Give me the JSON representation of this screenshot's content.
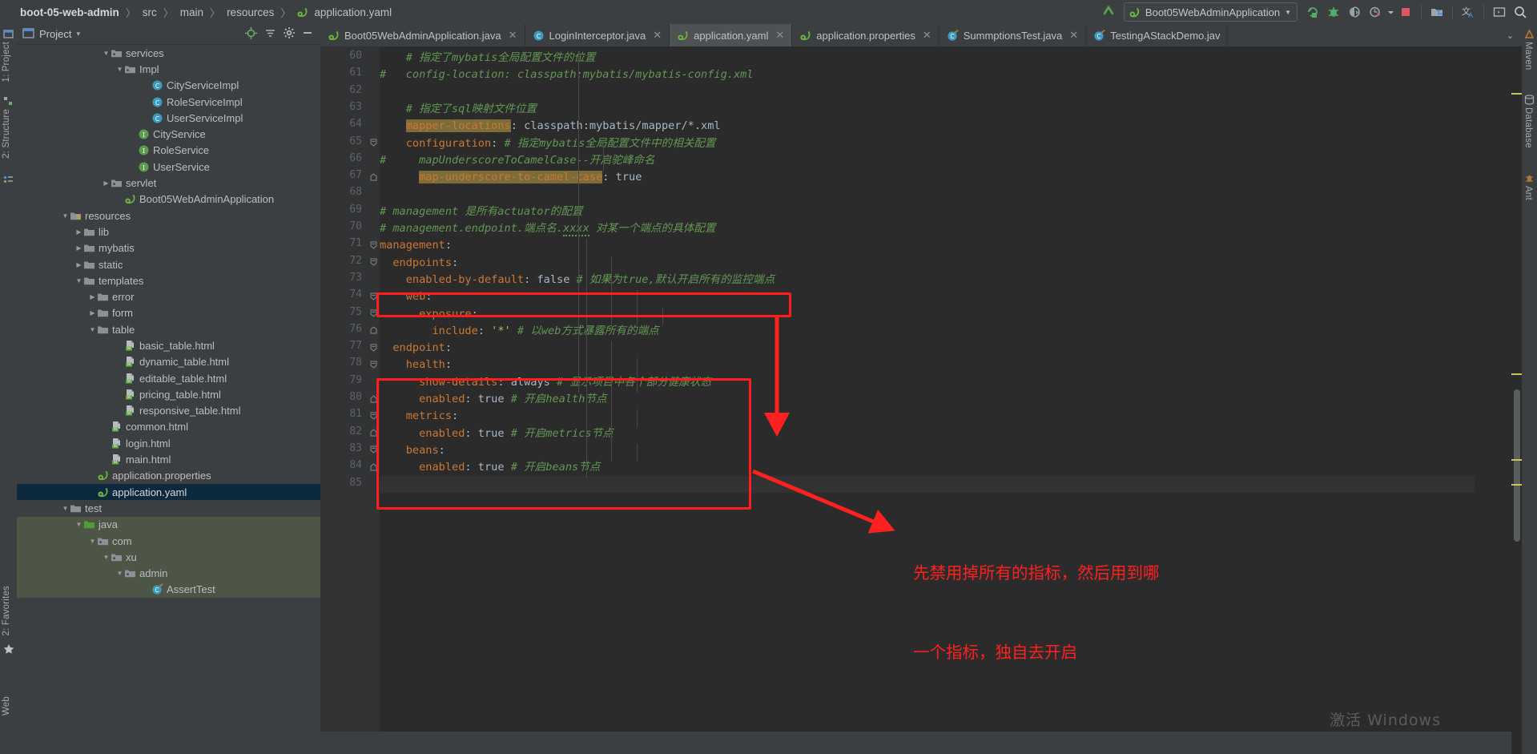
{
  "navbar": {
    "breadcrumbs": [
      "boot-05-web-admin",
      "src",
      "main",
      "resources",
      "application.yaml"
    ],
    "separator": "〉",
    "back_arrow": "↖",
    "run_config": "Boot05WebAdminApplication",
    "run_config_caret": "▼",
    "icons": [
      "rerun-icon",
      "debug-icon",
      "run-with-coverage-icon",
      "profiler-icon",
      "profiler-dropdown-icon",
      "stop-icon",
      "project-structure-icon",
      "translate-icon",
      "terminal-icon",
      "search-everywhere-icon"
    ]
  },
  "left_strip": {
    "project_label": "1: Project",
    "structure_label": "2: Structure",
    "favorites_label": "2: Favorites",
    "web_label": "Web"
  },
  "right_strip": {
    "maven_label": "Maven",
    "database_label": "Database",
    "ant_label": "Ant"
  },
  "project_panel": {
    "title": "Project",
    "caret": "▾",
    "header_icons": [
      "locate-icon",
      "collapse-all-icon",
      "settings-gear-icon",
      "hide-icon"
    ],
    "tree": [
      {
        "label": "services",
        "indent": 6,
        "arrow": "down",
        "icon": "package-folder",
        "type": "pkg"
      },
      {
        "label": "Impl",
        "indent": 7,
        "arrow": "down",
        "icon": "package-folder",
        "type": "pkg"
      },
      {
        "label": "CityServiceImpl",
        "indent": 9,
        "arrow": "none",
        "icon": "class-icon",
        "type": "class"
      },
      {
        "label": "RoleServiceImpl",
        "indent": 9,
        "arrow": "none",
        "icon": "class-icon",
        "type": "class"
      },
      {
        "label": "UserServiceImpl",
        "indent": 9,
        "arrow": "none",
        "icon": "class-icon",
        "type": "class"
      },
      {
        "label": "CityService",
        "indent": 8,
        "arrow": "none",
        "icon": "interface-icon",
        "type": "iface"
      },
      {
        "label": "RoleService",
        "indent": 8,
        "arrow": "none",
        "icon": "interface-icon",
        "type": "iface"
      },
      {
        "label": "UserService",
        "indent": 8,
        "arrow": "none",
        "icon": "interface-icon",
        "type": "iface"
      },
      {
        "label": "servlet",
        "indent": 6,
        "arrow": "right",
        "icon": "package-folder",
        "type": "pkg"
      },
      {
        "label": "Boot05WebAdminApplication",
        "indent": 7,
        "arrow": "none",
        "icon": "spring-class",
        "type": "spring"
      },
      {
        "label": "resources",
        "indent": 3,
        "arrow": "down",
        "icon": "resources-folder",
        "type": "res"
      },
      {
        "label": "lib",
        "indent": 4,
        "arrow": "right",
        "icon": "folder",
        "type": "folder"
      },
      {
        "label": "mybatis",
        "indent": 4,
        "arrow": "right",
        "icon": "folder",
        "type": "folder"
      },
      {
        "label": "static",
        "indent": 4,
        "arrow": "right",
        "icon": "folder",
        "type": "folder"
      },
      {
        "label": "templates",
        "indent": 4,
        "arrow": "down",
        "icon": "folder",
        "type": "folder"
      },
      {
        "label": "error",
        "indent": 5,
        "arrow": "right",
        "icon": "folder",
        "type": "folder"
      },
      {
        "label": "form",
        "indent": 5,
        "arrow": "right",
        "icon": "folder",
        "type": "folder"
      },
      {
        "label": "table",
        "indent": 5,
        "arrow": "down",
        "icon": "folder",
        "type": "folder"
      },
      {
        "label": "basic_table.html",
        "indent": 7,
        "arrow": "none",
        "icon": "html-file",
        "type": "html"
      },
      {
        "label": "dynamic_table.html",
        "indent": 7,
        "arrow": "none",
        "icon": "html-file",
        "type": "html"
      },
      {
        "label": "editable_table.html",
        "indent": 7,
        "arrow": "none",
        "icon": "html-file",
        "type": "html"
      },
      {
        "label": "pricing_table.html",
        "indent": 7,
        "arrow": "none",
        "icon": "html-file",
        "type": "html"
      },
      {
        "label": "responsive_table.html",
        "indent": 7,
        "arrow": "none",
        "icon": "html-file",
        "type": "html"
      },
      {
        "label": "common.html",
        "indent": 6,
        "arrow": "none",
        "icon": "html-file",
        "type": "html"
      },
      {
        "label": "login.html",
        "indent": 6,
        "arrow": "none",
        "icon": "html-file",
        "type": "html"
      },
      {
        "label": "main.html",
        "indent": 6,
        "arrow": "none",
        "icon": "html-file",
        "type": "html"
      },
      {
        "label": "application.properties",
        "indent": 5,
        "arrow": "none",
        "icon": "spring-file",
        "type": "spring"
      },
      {
        "label": "application.yaml",
        "indent": 5,
        "arrow": "none",
        "icon": "spring-file",
        "type": "spring",
        "selected": true
      },
      {
        "label": "test",
        "indent": 3,
        "arrow": "down",
        "icon": "folder",
        "type": "folder"
      },
      {
        "label": "java",
        "indent": 4,
        "arrow": "down",
        "icon": "source-folder",
        "type": "srcfolder",
        "testbg": true
      },
      {
        "label": "com",
        "indent": 5,
        "arrow": "down",
        "icon": "package-folder",
        "type": "pkg",
        "testbg": true
      },
      {
        "label": "xu",
        "indent": 6,
        "arrow": "down",
        "icon": "package-folder",
        "type": "pkg",
        "testbg": true
      },
      {
        "label": "admin",
        "indent": 7,
        "arrow": "down",
        "icon": "package-folder",
        "type": "pkg",
        "testbg": true
      },
      {
        "label": "AssertTest",
        "indent": 9,
        "arrow": "none",
        "icon": "test-class-icon",
        "type": "testclass",
        "testbg": true
      }
    ]
  },
  "editor": {
    "tabs": [
      {
        "label": "Boot05WebAdminApplication.java",
        "icon": "spring-class-icon",
        "active": false,
        "closable": true
      },
      {
        "label": "LoginInterceptor.java",
        "icon": "class-icon",
        "active": false,
        "closable": true
      },
      {
        "label": "application.yaml",
        "icon": "spring-file-icon",
        "active": true,
        "closable": true
      },
      {
        "label": "application.properties",
        "icon": "spring-file-icon",
        "active": false,
        "closable": true
      },
      {
        "label": "SummptionsTest.java",
        "icon": "test-class-icon",
        "active": false,
        "closable": true
      },
      {
        "label": "TestingAStackDemo.jav",
        "icon": "test-class-icon",
        "active": false,
        "closable": false
      }
    ],
    "tab_overflow_chevron": "⌄",
    "first_line_number": 60,
    "last_line_number": 85,
    "current_line": 85,
    "code_lines": [
      {
        "n": 60,
        "fold": "none",
        "segments": [
          {
            "t": "    # ",
            "c": "cm"
          },
          {
            "t": "指定了mybatis全局配置文件的位置",
            "c": "cm"
          }
        ]
      },
      {
        "n": 61,
        "fold": "none",
        "segments": [
          {
            "t": "#   config-location: classpath:mybatis/mybatis-config.xml",
            "c": "cm"
          }
        ]
      },
      {
        "n": 62,
        "fold": "none",
        "segments": []
      },
      {
        "n": 63,
        "fold": "none",
        "segments": [
          {
            "t": "    # ",
            "c": "cm"
          },
          {
            "t": "指定了sql映射文件位置",
            "c": "cm"
          }
        ]
      },
      {
        "n": 64,
        "fold": "none",
        "segments": [
          {
            "t": "    ",
            "c": "p"
          },
          {
            "t": "mapper-locations",
            "c": "k hl"
          },
          {
            "t": ": ",
            "c": "p"
          },
          {
            "t": "classpath:mybatis/mapper/*.xml",
            "c": "v"
          }
        ]
      },
      {
        "n": 65,
        "fold": "open",
        "segments": [
          {
            "t": "    ",
            "c": "p"
          },
          {
            "t": "configuration",
            "c": "k"
          },
          {
            "t": ": ",
            "c": "p"
          },
          {
            "t": "# 指定mybatis全局配置文件中的相关配置",
            "c": "cm"
          }
        ]
      },
      {
        "n": 66,
        "fold": "none",
        "segments": [
          {
            "t": "#     mapUnderscoreToCamelCase--开启驼峰命名",
            "c": "cm"
          }
        ]
      },
      {
        "n": 67,
        "fold": "close",
        "segments": [
          {
            "t": "      ",
            "c": "p"
          },
          {
            "t": "map-underscore-to-camel-case",
            "c": "k hl"
          },
          {
            "t": ": ",
            "c": "p"
          },
          {
            "t": "true",
            "c": "v"
          }
        ]
      },
      {
        "n": 68,
        "fold": "none",
        "segments": []
      },
      {
        "n": 69,
        "fold": "none",
        "segments": [
          {
            "t": "# management 是所有actuator的配置",
            "c": "cm"
          }
        ]
      },
      {
        "n": 70,
        "fold": "none",
        "segments": [
          {
            "t": "# management.endpoint.端点名.",
            "c": "cm"
          },
          {
            "t": "xxxx",
            "c": "cm squig"
          },
          {
            "t": " 对某一个端点的具体配置",
            "c": "cm"
          }
        ]
      },
      {
        "n": 71,
        "fold": "open",
        "segments": [
          {
            "t": "management",
            "c": "k"
          },
          {
            "t": ":",
            "c": "p"
          }
        ]
      },
      {
        "n": 72,
        "fold": "open",
        "segments": [
          {
            "t": "  ",
            "c": "p"
          },
          {
            "t": "endpoints",
            "c": "k"
          },
          {
            "t": ":",
            "c": "p"
          }
        ]
      },
      {
        "n": 73,
        "fold": "none",
        "segments": [
          {
            "t": "    ",
            "c": "p"
          },
          {
            "t": "enabled-by-default",
            "c": "k"
          },
          {
            "t": ": ",
            "c": "p"
          },
          {
            "t": "false",
            "c": "v"
          },
          {
            "t": " # 如果为true,默认开启所有的监控端点",
            "c": "cm"
          }
        ]
      },
      {
        "n": 74,
        "fold": "open",
        "segments": [
          {
            "t": "    ",
            "c": "p"
          },
          {
            "t": "web",
            "c": "k"
          },
          {
            "t": ":",
            "c": "p"
          }
        ]
      },
      {
        "n": 75,
        "fold": "open",
        "segments": [
          {
            "t": "      ",
            "c": "p"
          },
          {
            "t": "exposure",
            "c": "k"
          },
          {
            "t": ":",
            "c": "p"
          }
        ]
      },
      {
        "n": 76,
        "fold": "close",
        "segments": [
          {
            "t": "        ",
            "c": "p"
          },
          {
            "t": "include",
            "c": "k"
          },
          {
            "t": ": ",
            "c": "p"
          },
          {
            "t": "'*'",
            "c": "s"
          },
          {
            "t": " # 以web方式暴露所有的端点",
            "c": "cm"
          }
        ]
      },
      {
        "n": 77,
        "fold": "open",
        "segments": [
          {
            "t": "  ",
            "c": "p"
          },
          {
            "t": "endpoint",
            "c": "k"
          },
          {
            "t": ":",
            "c": "p"
          }
        ]
      },
      {
        "n": 78,
        "fold": "open",
        "segments": [
          {
            "t": "    ",
            "c": "p"
          },
          {
            "t": "health",
            "c": "k"
          },
          {
            "t": ":",
            "c": "p"
          }
        ]
      },
      {
        "n": 79,
        "fold": "none",
        "segments": [
          {
            "t": "      ",
            "c": "p"
          },
          {
            "t": "show-details",
            "c": "k"
          },
          {
            "t": ": ",
            "c": "p"
          },
          {
            "t": "always",
            "c": "v"
          },
          {
            "t": " # 显示项目中各个部分健康状态",
            "c": "cm"
          }
        ]
      },
      {
        "n": 80,
        "fold": "close",
        "segments": [
          {
            "t": "      ",
            "c": "p"
          },
          {
            "t": "enabled",
            "c": "k"
          },
          {
            "t": ": ",
            "c": "p"
          },
          {
            "t": "true",
            "c": "v"
          },
          {
            "t": " # 开启health节点",
            "c": "cm"
          }
        ]
      },
      {
        "n": 81,
        "fold": "open",
        "segments": [
          {
            "t": "    ",
            "c": "p"
          },
          {
            "t": "metrics",
            "c": "k"
          },
          {
            "t": ":",
            "c": "p"
          }
        ]
      },
      {
        "n": 82,
        "fold": "close",
        "segments": [
          {
            "t": "      ",
            "c": "p"
          },
          {
            "t": "enabled",
            "c": "k"
          },
          {
            "t": ": ",
            "c": "p"
          },
          {
            "t": "true",
            "c": "v"
          },
          {
            "t": " # 开启metrics节点",
            "c": "cm"
          }
        ]
      },
      {
        "n": 83,
        "fold": "open",
        "segments": [
          {
            "t": "    ",
            "c": "p"
          },
          {
            "t": "beans",
            "c": "k"
          },
          {
            "t": ":",
            "c": "p"
          }
        ]
      },
      {
        "n": 84,
        "fold": "close",
        "segments": [
          {
            "t": "      ",
            "c": "p"
          },
          {
            "t": "enabled",
            "c": "k"
          },
          {
            "t": ": ",
            "c": "p"
          },
          {
            "t": "true",
            "c": "v"
          },
          {
            "t": " # 开启beans节点",
            "c": "cm"
          }
        ]
      },
      {
        "n": 85,
        "fold": "none",
        "segments": []
      }
    ]
  },
  "annotations": {
    "color": "#ff2020",
    "note_line1": "先禁用掉所有的指标，然后用到哪",
    "note_line2": "一个指标，独自去开启",
    "boxes": [
      "highlight-box-enabled-by-default",
      "highlight-box-endpoint-block"
    ],
    "arrows": [
      "arrow-down-to-endpoint",
      "arrow-to-note"
    ]
  },
  "watermark": "激活 Windows"
}
